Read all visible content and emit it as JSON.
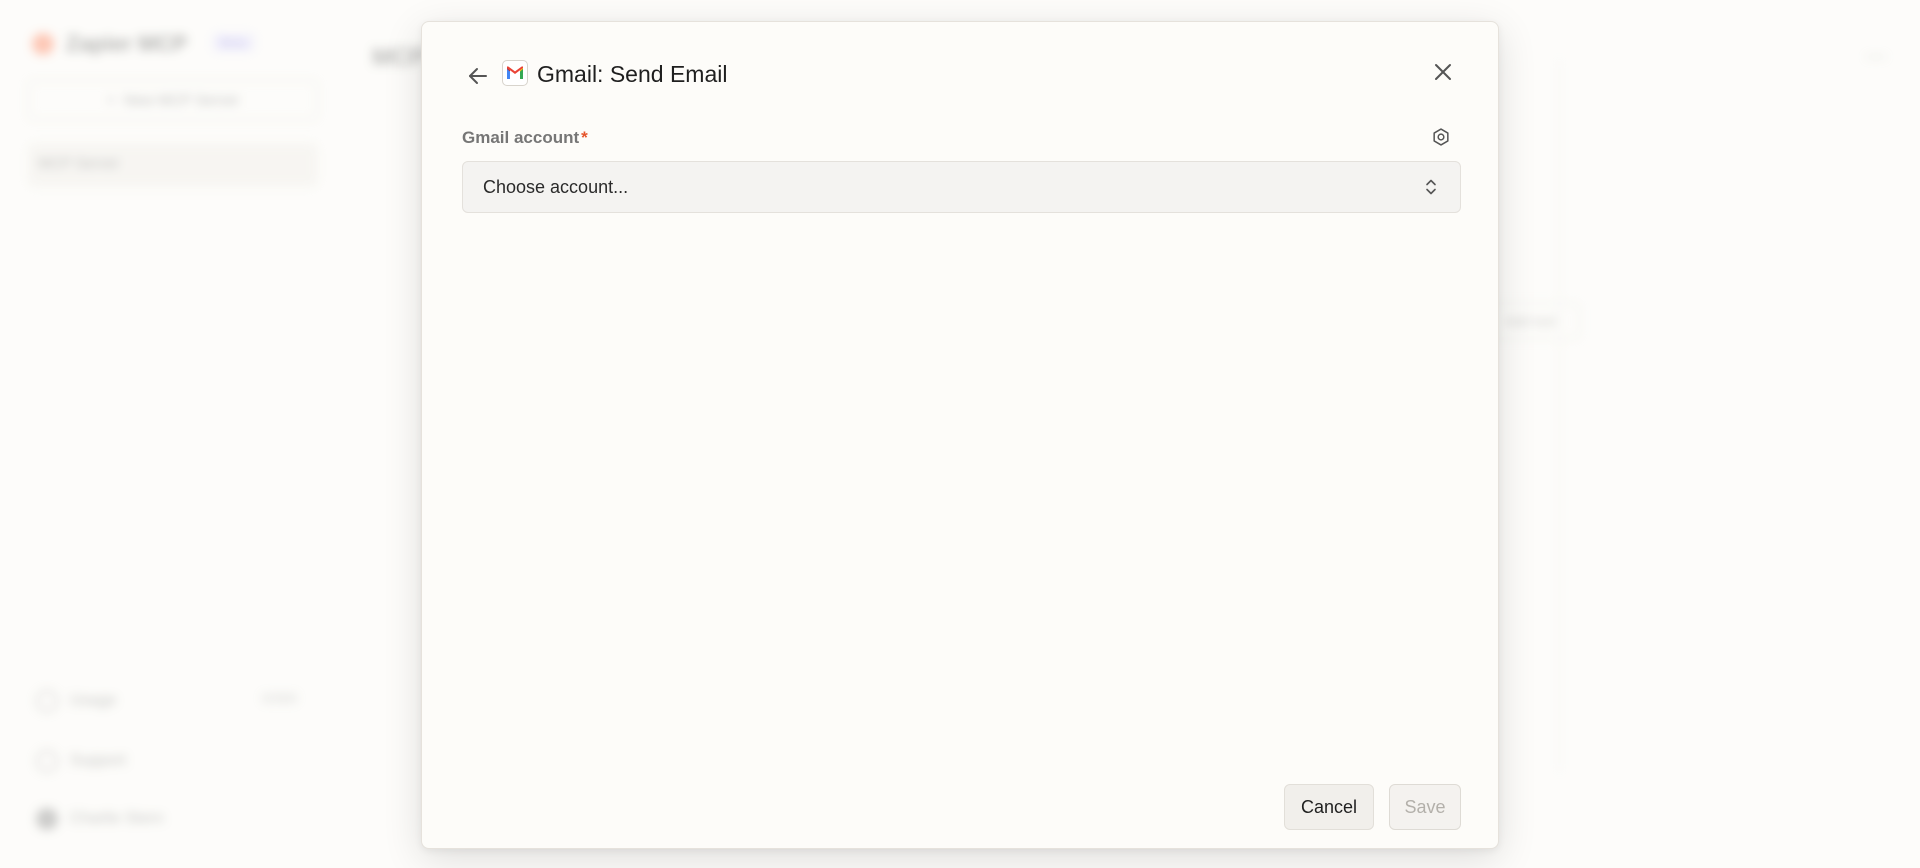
{
  "background": {
    "brand_name": "Zapier MCP",
    "brand_badge": "Beta",
    "new_server_label": "New MCP Server",
    "sidebar_item": "MCP Server",
    "usage_label": "Usage",
    "usage_count": "0/300",
    "support_label": "Support",
    "user_label": "Charlie Stern",
    "main_title": "MCP",
    "main_button_label": "Add tool",
    "main_menu": "—"
  },
  "modal": {
    "title": "Gmail: Send Email",
    "app_icon": "gmail-icon",
    "field": {
      "label": "Gmail account",
      "required_mark": "*",
      "placeholder": "Choose account..."
    },
    "buttons": {
      "cancel": "Cancel",
      "save": "Save"
    }
  },
  "colors": {
    "required": "#e5542b",
    "gmail_red": "#EA4335",
    "gmail_blue": "#4285F4",
    "gmail_green": "#34A853",
    "gmail_yellow": "#FBBC04"
  }
}
